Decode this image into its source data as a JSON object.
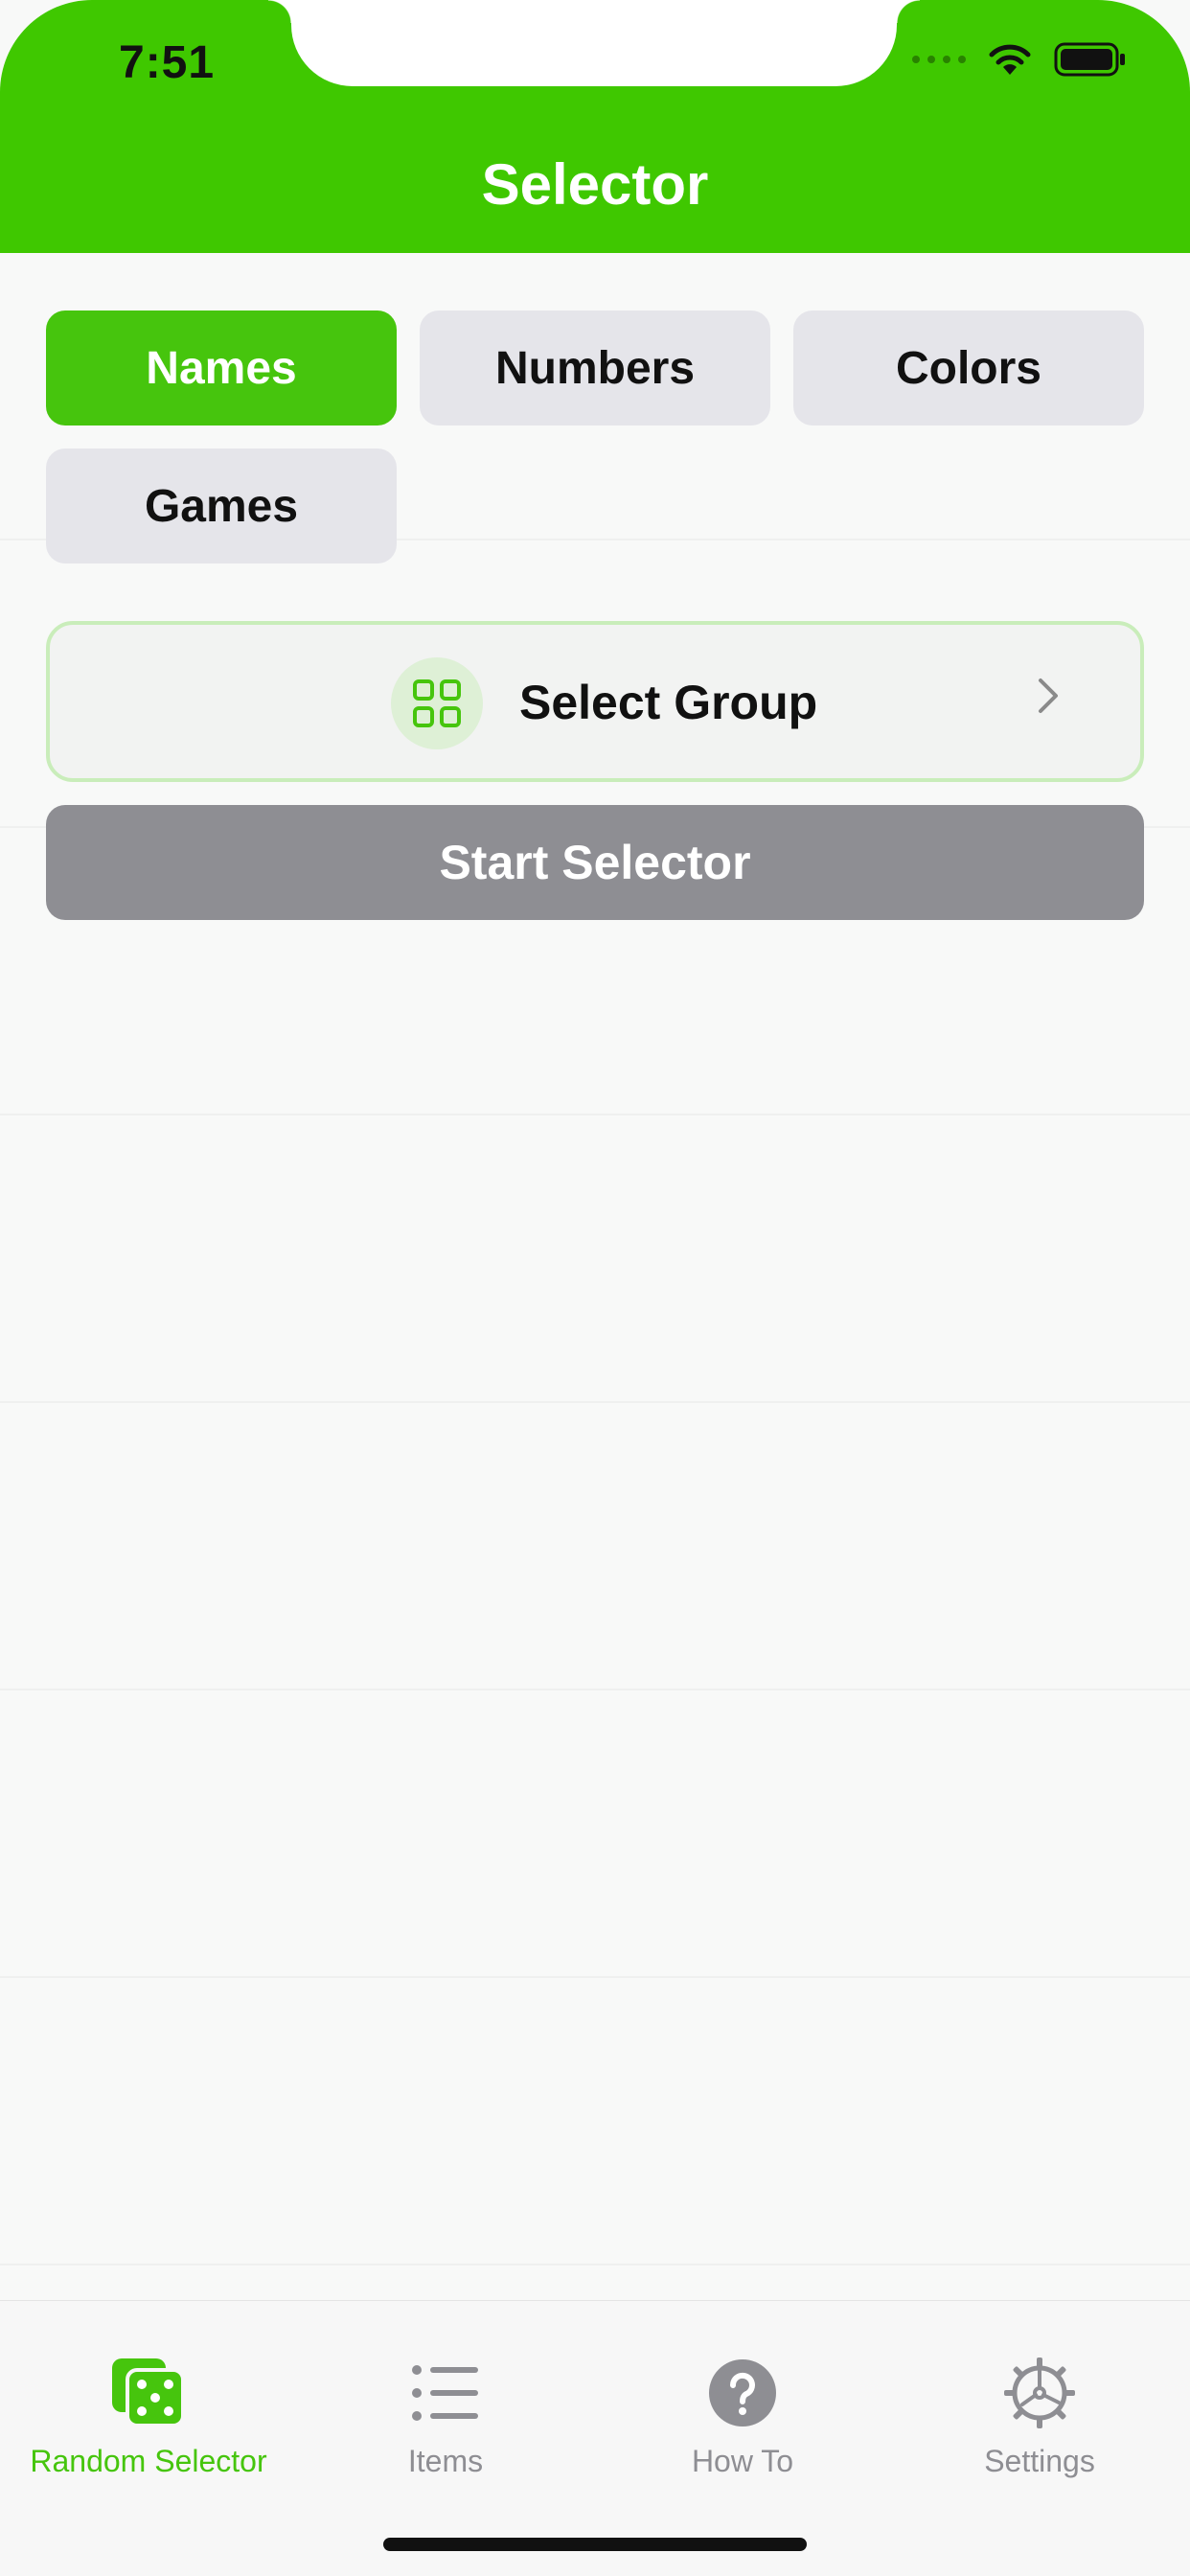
{
  "status_bar": {
    "time": "7:51"
  },
  "nav": {
    "title": "Selector"
  },
  "categories": {
    "names": "Names",
    "numbers": "Numbers",
    "colors": "Colors",
    "games": "Games",
    "selected": "Names"
  },
  "group_selector": {
    "label": "Select Group",
    "icon": "grid-icon"
  },
  "start_button": {
    "label": "Start Selector",
    "enabled": false
  },
  "tabbar": {
    "tabs": [
      {
        "label": "Random Selector",
        "icon": "dice-icon",
        "active": true
      },
      {
        "label": "Items",
        "icon": "list-icon",
        "active": false
      },
      {
        "label": "How To",
        "icon": "question-icon",
        "active": false
      },
      {
        "label": "Settings",
        "icon": "gear-icon",
        "active": false
      }
    ]
  },
  "colors": {
    "accent": "#46c50d",
    "header": "#3fc800",
    "inactive": "#8e8e93",
    "segment_bg": "#e5e5ea"
  }
}
